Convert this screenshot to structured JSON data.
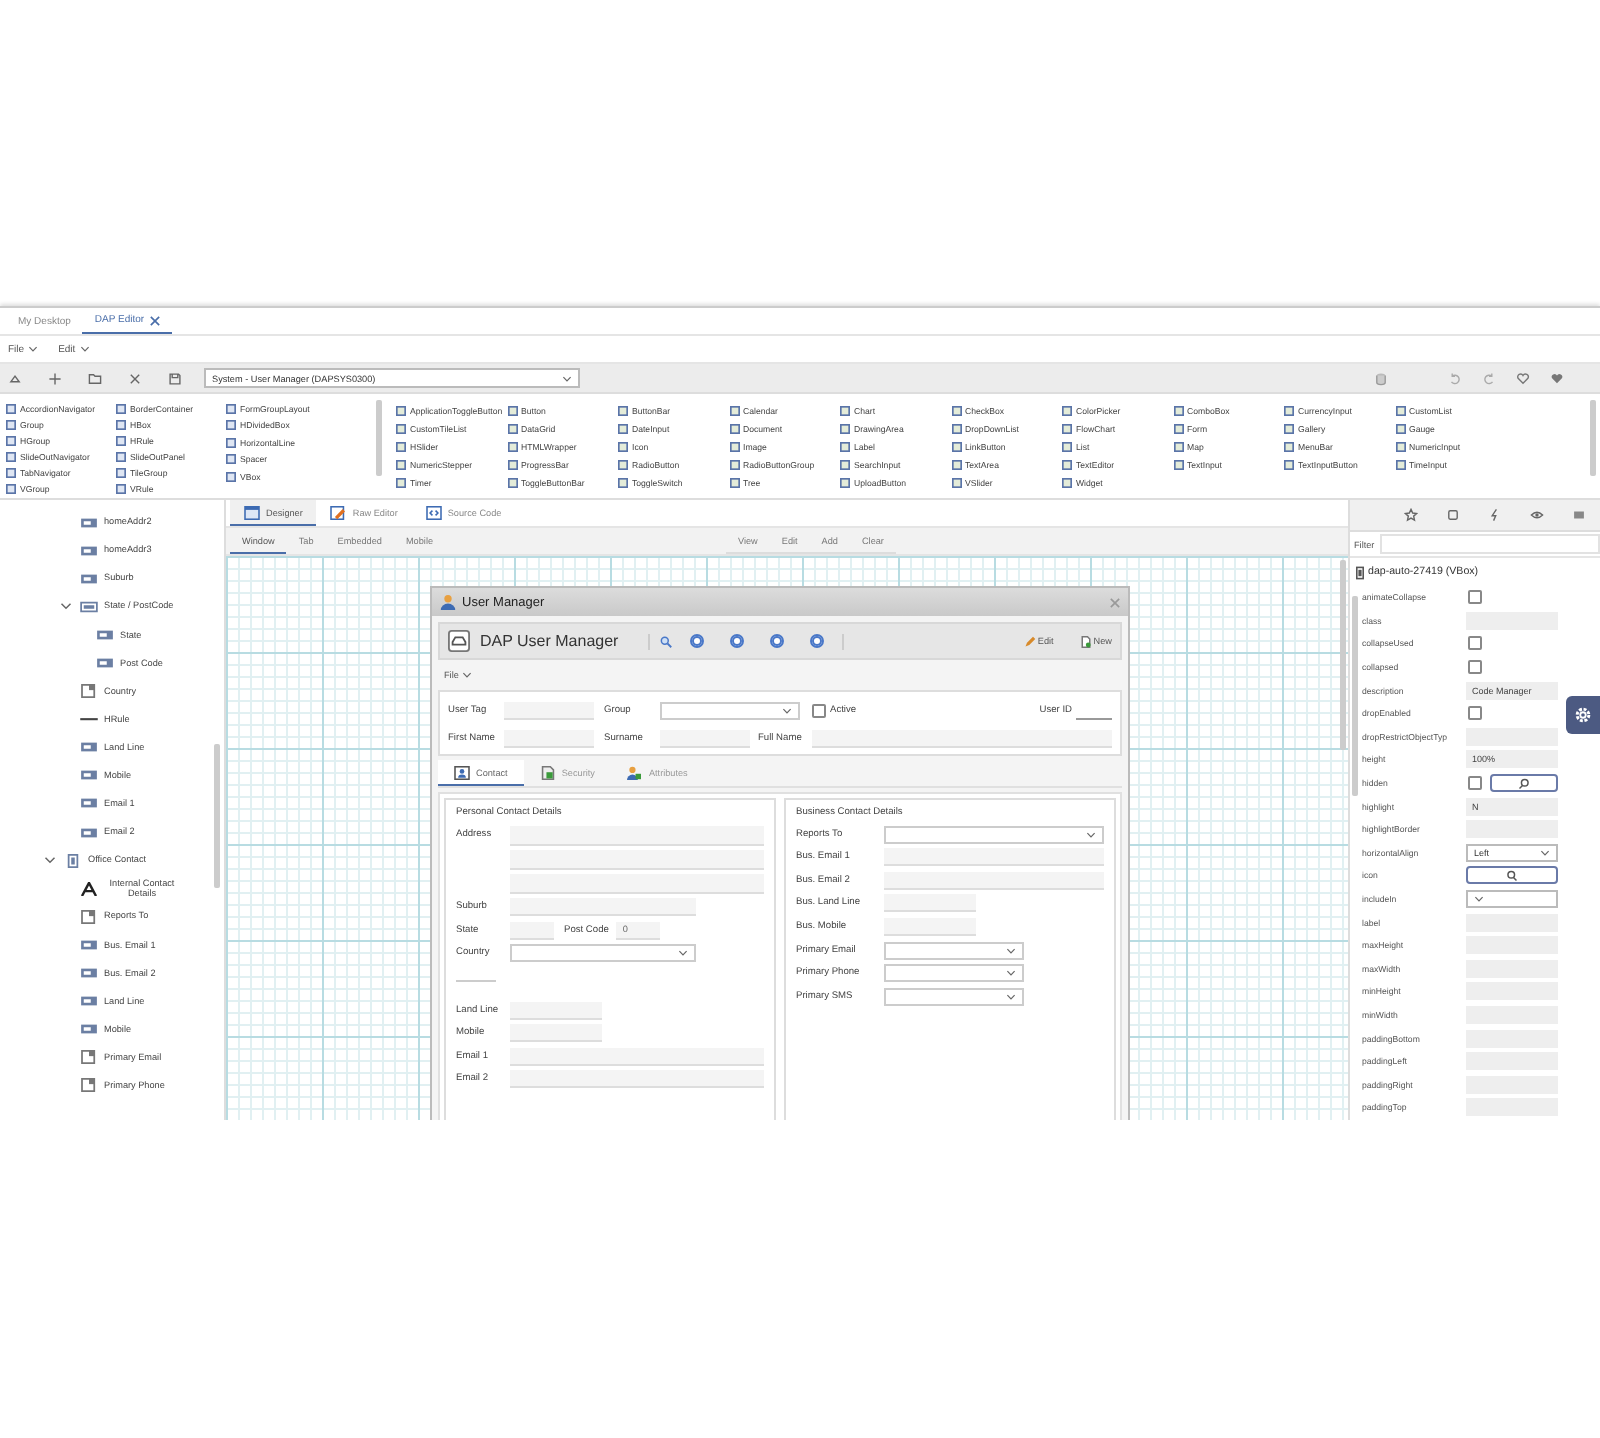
{
  "app_tabs": [
    {
      "label": "My Desktop",
      "selected": false,
      "closable": false
    },
    {
      "label": "DAP Editor",
      "selected": true,
      "closable": true
    }
  ],
  "menu": [
    {
      "label": "File"
    },
    {
      "label": "Edit"
    }
  ],
  "toolbar": {
    "form_select": "System - User Manager (DAPSYS0300)"
  },
  "palette": {
    "layout_columns": [
      [
        "AccordionNavigator",
        "Group",
        "HGroup",
        "SlideOutNavigator",
        "TabNavigator",
        "VGroup"
      ],
      [
        "BorderContainer",
        "HBox",
        "HRule",
        "SlideOutPanel",
        "TileGroup",
        "VRule"
      ],
      [
        "FormGroupLayout",
        "HDividedBox",
        "HorizontalLine",
        "Spacer",
        "VBox"
      ]
    ],
    "control_columns": [
      [
        "ApplicationToggleButton",
        "CustomTileList",
        "HSlider",
        "NumericStepper",
        "Timer"
      ],
      [
        "Button",
        "DataGrid",
        "HTMLWrapper",
        "ProgressBar",
        "ToggleButtonBar"
      ],
      [
        "ButtonBar",
        "DateInput",
        "Icon",
        "RadioButton",
        "ToggleSwitch"
      ],
      [
        "Calendar",
        "Document",
        "Image",
        "RadioButtonGroup",
        "Tree"
      ],
      [
        "Chart",
        "DrawingArea",
        "Label",
        "SearchInput",
        "UploadButton"
      ],
      [
        "CheckBox",
        "DropDownList",
        "LinkButton",
        "TextArea",
        "VSlider"
      ],
      [
        "ColorPicker",
        "FlowChart",
        "List",
        "TextEditor",
        "Widget"
      ],
      [
        "ComboBox",
        "Form",
        "Map",
        "TextInput"
      ],
      [
        "CurrencyInput",
        "Gallery",
        "MenuBar",
        "TextInputButton"
      ],
      [
        "CustomList",
        "Gauge",
        "NumericInput",
        "TimeInput"
      ]
    ]
  },
  "designer_tabs": [
    {
      "label": "Designer",
      "selected": true,
      "kind": "designer"
    },
    {
      "label": "Raw Editor",
      "selected": false,
      "kind": "raw"
    },
    {
      "label": "Source Code",
      "selected": false,
      "kind": "source"
    }
  ],
  "view_modes": [
    {
      "label": "Window",
      "selected": true
    },
    {
      "label": "Tab",
      "selected": false
    },
    {
      "label": "Embedded",
      "selected": false
    },
    {
      "label": "Mobile",
      "selected": false
    }
  ],
  "canvas_actions": [
    "View",
    "Edit",
    "Add",
    "Clear"
  ],
  "tree": {
    "scrolled_branch": [
      {
        "label": "homeAddr2",
        "kind": "input"
      },
      {
        "label": "homeAddr3",
        "kind": "input"
      },
      {
        "label": "Suburb",
        "kind": "input"
      },
      {
        "label": "State / PostCode",
        "kind": "group",
        "expanded": true,
        "children": [
          {
            "label": "State",
            "kind": "input"
          },
          {
            "label": "Post Code",
            "kind": "input"
          }
        ]
      },
      {
        "label": "Country",
        "kind": "select"
      },
      {
        "label": "HRule",
        "kind": "rule"
      },
      {
        "label": "Land Line",
        "kind": "input"
      },
      {
        "label": "Mobile",
        "kind": "input"
      },
      {
        "label": "Email 1",
        "kind": "input"
      },
      {
        "label": "Email 2",
        "kind": "input"
      }
    ],
    "nodes": [
      {
        "label": "Office Contact",
        "kind": "vgroup",
        "expanded": true,
        "children": [
          {
            "label": "Internal Contact Details",
            "kind": "label"
          },
          {
            "label": "Reports To",
            "kind": "select"
          },
          {
            "label": "Bus. Email 1",
            "kind": "input"
          },
          {
            "label": "Bus. Email 2",
            "kind": "input"
          },
          {
            "label": "Land Line",
            "kind": "input"
          },
          {
            "label": "Mobile",
            "kind": "input"
          },
          {
            "label": "Primary Email",
            "kind": "select"
          },
          {
            "label": "Primary Phone",
            "kind": "select"
          }
        ]
      }
    ]
  },
  "user_manager": {
    "title": "User Manager",
    "header": "DAP User Manager",
    "actions": [
      {
        "label": "Edit",
        "kind": "edit"
      },
      {
        "label": "New",
        "kind": "new"
      }
    ],
    "menu": "File",
    "user_tag": "User Tag",
    "group": "Group",
    "active": {
      "label": "Active",
      "checked": false
    },
    "user_id": "User ID",
    "first_name": "First Name",
    "surname": "Surname",
    "full_name": "Full Name",
    "tabs": [
      {
        "label": "Contact",
        "selected": true,
        "kind": "contact"
      },
      {
        "label": "Security",
        "selected": false,
        "kind": "security"
      },
      {
        "label": "Attributes",
        "selected": false,
        "kind": "attributes"
      }
    ],
    "personal": {
      "title": "Personal Contact Details",
      "rows": [
        {
          "label": "Address",
          "kind": "address"
        },
        {
          "label": "Suburb",
          "kind": "medium_text"
        },
        {
          "label": "State",
          "kind": "pair",
          "second_label": "Post Code",
          "second_value": "0"
        },
        {
          "label": "Country",
          "kind": "medium_select"
        },
        {
          "kind": "rule"
        },
        {
          "label": "Land Line",
          "kind": "short_text"
        },
        {
          "label": "Mobile",
          "kind": "short_text"
        },
        {
          "label": "Email 1",
          "kind": "wide_text"
        },
        {
          "label": "Email 2",
          "kind": "wide_text"
        }
      ]
    },
    "business": {
      "title": "Business Contact Details",
      "rows": [
        {
          "label": "Reports To",
          "kind": "wide_select"
        },
        {
          "label": "Bus. Email 1",
          "kind": "wide_text"
        },
        {
          "label": "Bus. Email 2",
          "kind": "wide_text"
        },
        {
          "label": "Bus. Land Line",
          "kind": "short_text"
        },
        {
          "label": "Bus. Mobile",
          "kind": "short_text"
        },
        {
          "label": "Primary Email",
          "kind": "select"
        },
        {
          "label": "Primary Phone",
          "kind": "select"
        },
        {
          "label": "Primary SMS",
          "kind": "select"
        }
      ]
    }
  },
  "properties": {
    "filter_label": "Filter",
    "selected_component": "dap-auto-27419 (VBox)",
    "rows": [
      {
        "name": "animateCollapse",
        "kind": "checkbox",
        "checked": false
      },
      {
        "name": "class",
        "kind": "field"
      },
      {
        "name": "collapseUsed",
        "kind": "checkbox",
        "checked": false
      },
      {
        "name": "collapsed",
        "kind": "checkbox",
        "checked": false
      },
      {
        "name": "description",
        "kind": "field",
        "value": "Code Manager"
      },
      {
        "name": "dropEnabled",
        "kind": "checkbox",
        "checked": false
      },
      {
        "name": "dropRestrictObjectTyp",
        "kind": "field"
      },
      {
        "name": "height",
        "kind": "field",
        "value": "100%"
      },
      {
        "name": "hidden",
        "kind": "checkbox_search",
        "checked": false
      },
      {
        "name": "highlight",
        "kind": "field",
        "value": "N"
      },
      {
        "name": "highlightBorder",
        "kind": "field"
      },
      {
        "name": "horizontalAlign",
        "kind": "dropdown",
        "value": "Left"
      },
      {
        "name": "icon",
        "kind": "search"
      },
      {
        "name": "includeIn",
        "kind": "dropdown"
      },
      {
        "name": "label",
        "kind": "field"
      },
      {
        "name": "maxHeight",
        "kind": "field"
      },
      {
        "name": "maxWidth",
        "kind": "field"
      },
      {
        "name": "minHeight",
        "kind": "field"
      },
      {
        "name": "minWidth",
        "kind": "field"
      },
      {
        "name": "paddingBottom",
        "kind": "field"
      },
      {
        "name": "paddingLeft",
        "kind": "field"
      },
      {
        "name": "paddingRight",
        "kind": "field"
      },
      {
        "name": "paddingTop",
        "kind": "field"
      }
    ]
  }
}
